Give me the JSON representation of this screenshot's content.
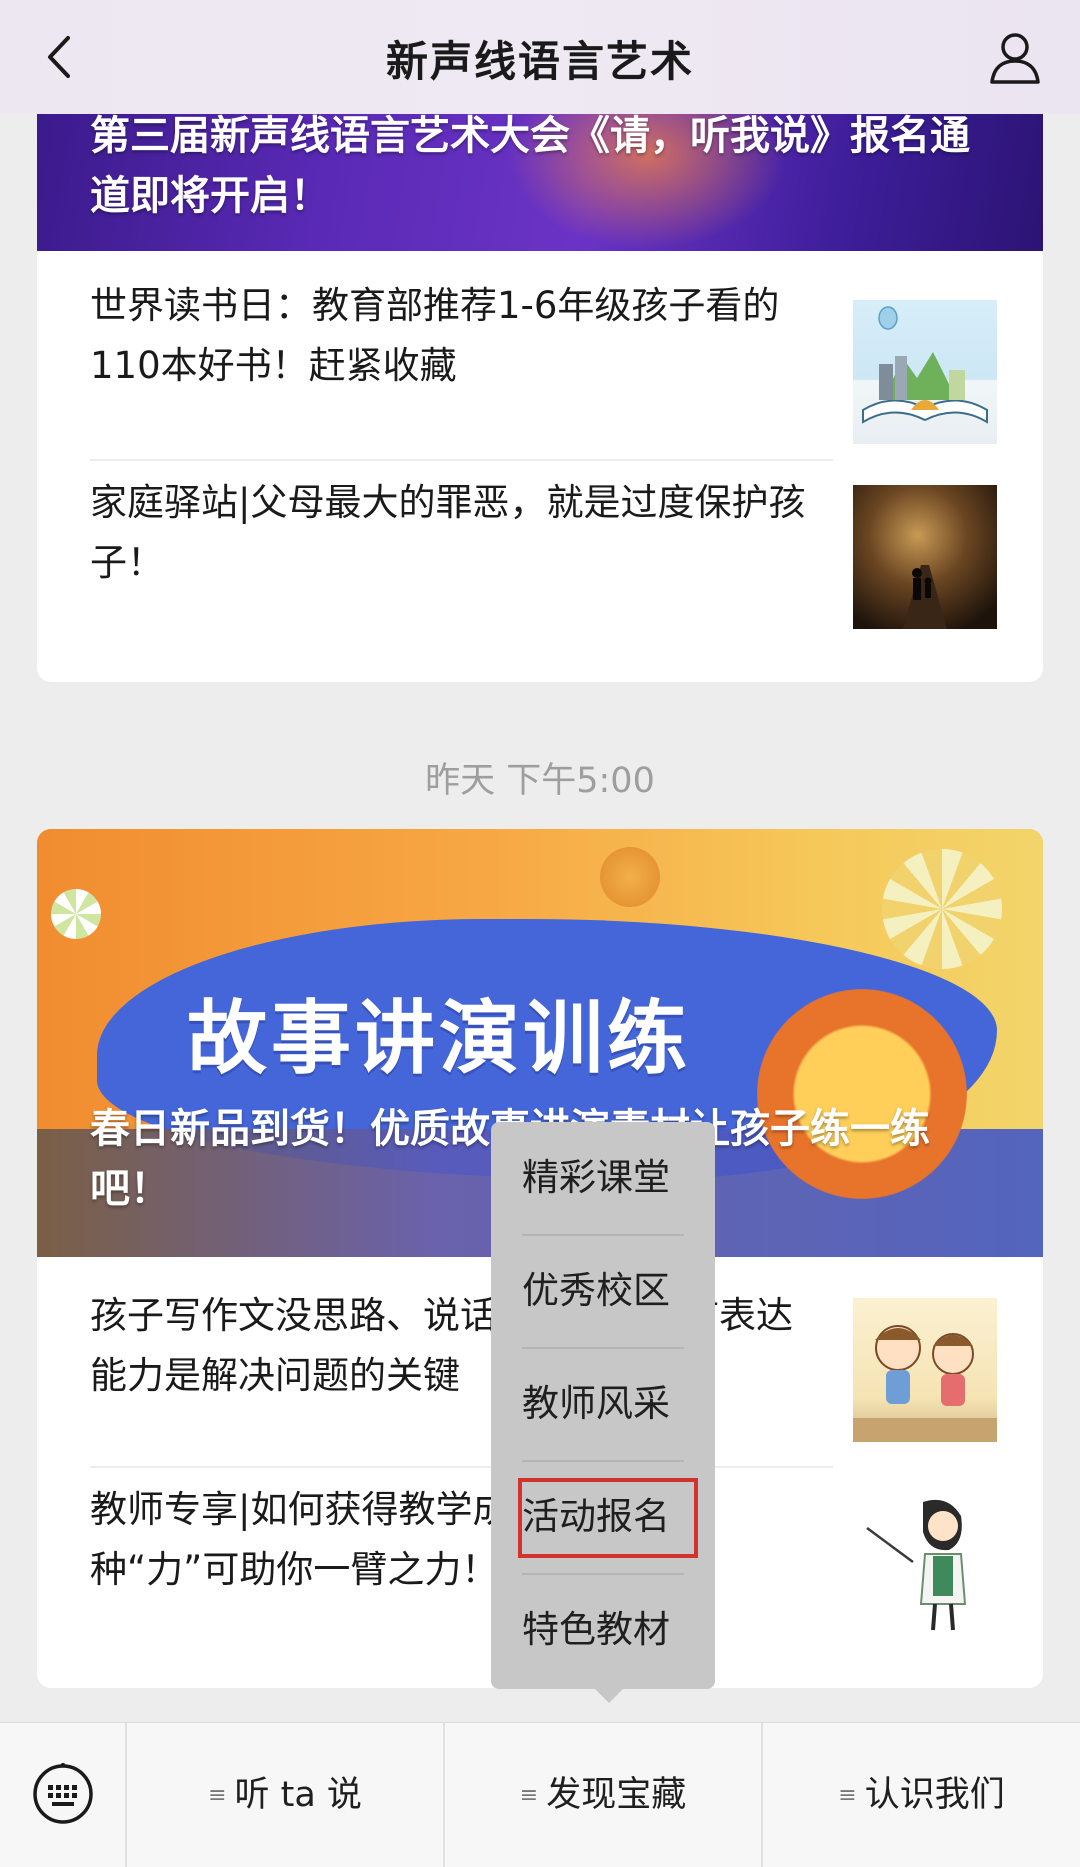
{
  "header": {
    "title": "新声线语言艺术",
    "back_icon": "chevron-left-icon",
    "user_icon": "user-icon"
  },
  "feed1": {
    "banner_title": "第三届新声线语言艺术大会《请，听我说》报名通道即将开启！",
    "items": [
      {
        "title": "世界读书日：教育部推荐1-6年级孩子看的110本好书！赶紧收藏"
      },
      {
        "title": "家庭驿站|父母最大的罪恶，就是过度保护孩子！"
      }
    ]
  },
  "timestamp": "昨天 下午5:00",
  "feed2": {
    "banner_big_text": "故事讲演训练",
    "banner_title": "春日新品到货！优质故事讲演素材让孩子练一练吧！",
    "items": [
      {
        "title": "孩子写作文没思路、说话没逻辑？语言表达能力是解决问题的关键"
      },
      {
        "title": "教师专享|如何获得教学成就感？这三种“力”可助你一臂之力！"
      }
    ]
  },
  "popup_menu": {
    "items": [
      "精彩课堂",
      "优秀校区",
      "教师风采",
      "活动报名",
      "特色教材"
    ],
    "highlighted": "活动报名",
    "highlight_color": "#d0342c"
  },
  "bottom_bar": {
    "keyboard_icon": "keyboard-icon",
    "tabs": [
      "听 ta 说",
      "发现宝藏",
      "认识我们"
    ]
  }
}
